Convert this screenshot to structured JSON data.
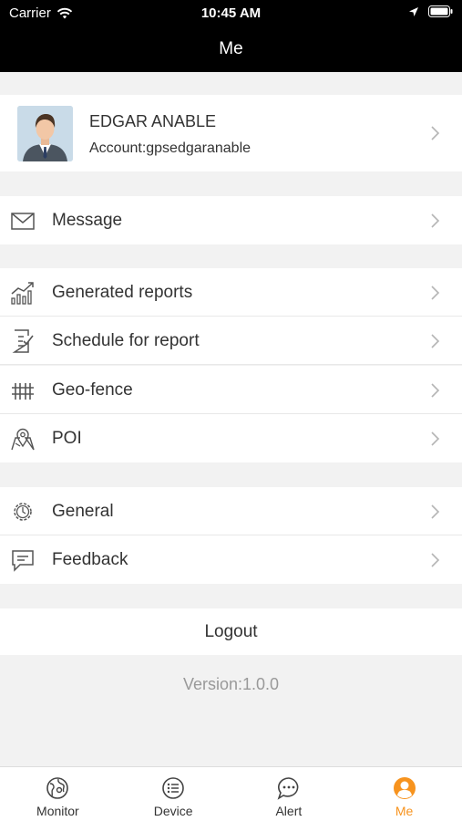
{
  "status_bar": {
    "carrier": "Carrier",
    "time": "10:45 AM"
  },
  "nav": {
    "title": "Me"
  },
  "profile": {
    "name": "EDGAR ANABLE",
    "account": "Account:gpsedgaranable"
  },
  "menu": {
    "message": "Message",
    "generated_reports": "Generated reports",
    "schedule_report": "Schedule for report",
    "geo_fence": "Geo-fence",
    "poi": "POI",
    "general": "General",
    "feedback": "Feedback"
  },
  "logout": "Logout",
  "version": "Version:1.0.0",
  "tabs": {
    "monitor": "Monitor",
    "device": "Device",
    "alert": "Alert",
    "me": "Me"
  },
  "colors": {
    "accent": "#f7931e",
    "text": "#333333",
    "muted": "#999999",
    "icon": "#555555"
  }
}
